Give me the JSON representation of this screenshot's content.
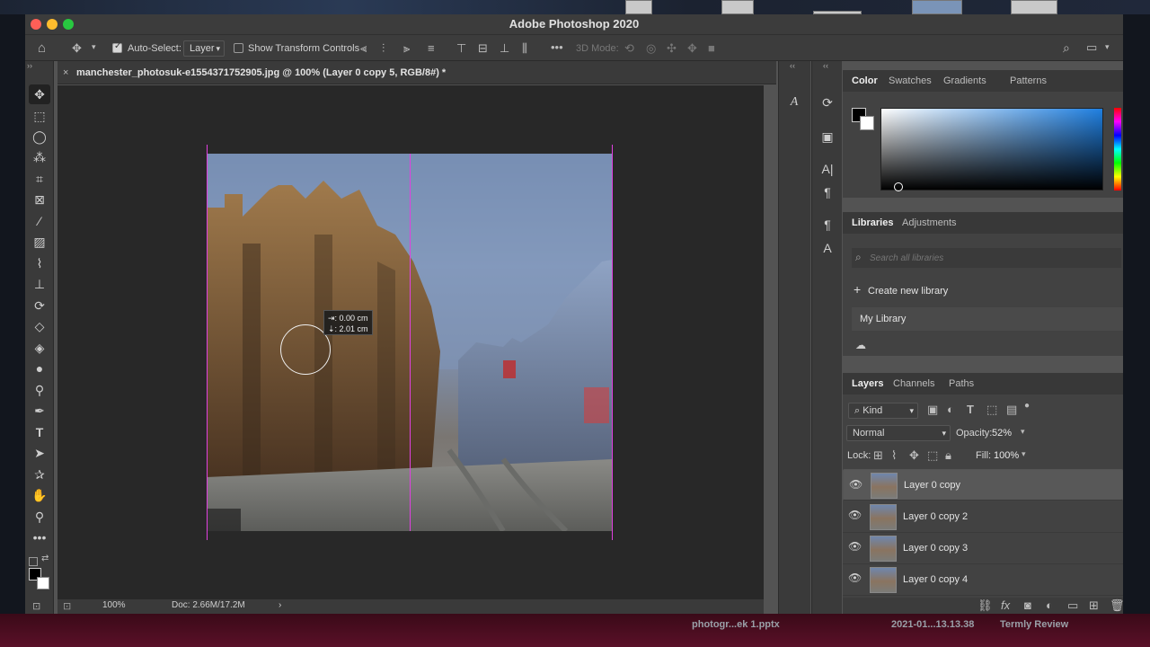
{
  "window": {
    "title": "Adobe Photoshop 2020"
  },
  "options_bar": {
    "auto_select_label": "Auto-Select:",
    "auto_select_target": "Layer",
    "transform_controls_label": "Show Transform Controls",
    "mode_3d_label": "3D Mode:"
  },
  "document": {
    "tab_title": "manchester_photosuk-e1554371752905.jpg @ 100% (Layer 0 copy 5, RGB/8#) *",
    "close_glyph": "×",
    "zoom": "100%",
    "doc_info": "Doc: 2.66M/17.2M",
    "status_arrow": "›",
    "measure_x": "⇥: 0.00 cm",
    "measure_y": "⇣: 2.01 cm"
  },
  "color_panel": {
    "tabs": [
      "Color",
      "Swatches",
      "Gradients",
      "Patterns"
    ]
  },
  "libraries_panel": {
    "tabs": [
      "Libraries",
      "Adjustments"
    ],
    "search_placeholder": "Search all libraries",
    "create_label": "Create new library",
    "library_name": "My Library"
  },
  "layers_panel": {
    "tabs": [
      "Layers",
      "Channels",
      "Paths"
    ],
    "filter_kind": "Kind",
    "blend_mode": "Normal",
    "opacity_label": "Opacity:",
    "opacity_value": "52%",
    "lock_label": "Lock:",
    "fill_label": "Fill:",
    "fill_value": "100%",
    "layers": [
      "Layer 0 copy",
      "Layer 0 copy 2",
      "Layer 0 copy 3",
      "Layer 0 copy 4"
    ]
  },
  "desktop": {
    "dock_item_1": "photogr...ek 1.pptx",
    "dock_item_2": "2021-01...13.13.38",
    "dock_item_3": "Termly Review"
  },
  "colors": {
    "guide": "#e040e0",
    "panel_bg": "#424242",
    "canvas_bg": "#282828"
  }
}
